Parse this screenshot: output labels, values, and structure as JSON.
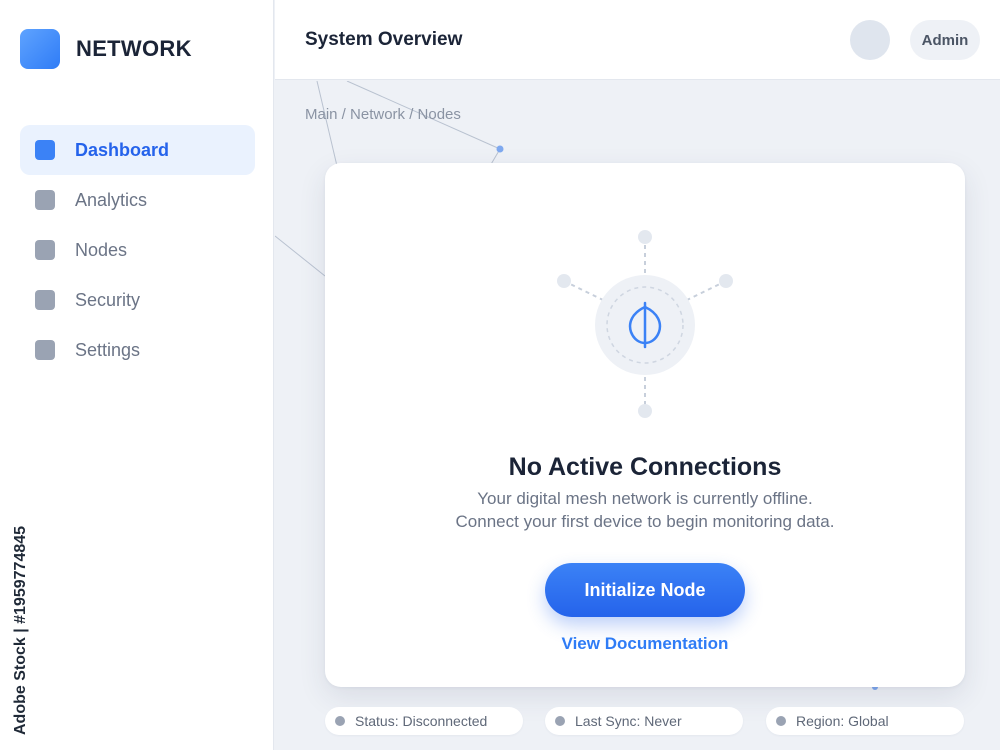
{
  "brand": {
    "name": "NETWORK"
  },
  "sidebar": {
    "items": [
      {
        "label": "Dashboard",
        "active": true
      },
      {
        "label": "Analytics",
        "active": false
      },
      {
        "label": "Nodes",
        "active": false
      },
      {
        "label": "Security",
        "active": false
      },
      {
        "label": "Settings",
        "active": false
      }
    ]
  },
  "header": {
    "title": "System Overview",
    "user_label": "Admin"
  },
  "breadcrumb": "Main / Network / Nodes",
  "empty_state": {
    "icon": "network-hub-icon",
    "title": "No Active Connections",
    "description_line1": "Your digital mesh network is currently offline.",
    "description_line2": "Connect your first device to begin monitoring data.",
    "primary_button": "Initialize Node",
    "secondary_link": "View Documentation"
  },
  "status_bar": {
    "status": "Status: Disconnected",
    "last_sync": "Last Sync: Never",
    "region": "Region: Global"
  },
  "watermark": "Adobe Stock | #1959774845",
  "colors": {
    "accent": "#2563eb",
    "accent_light": "#3b82f6",
    "active_nav_bg": "#eaf2fe",
    "background": "#eef1f6"
  }
}
